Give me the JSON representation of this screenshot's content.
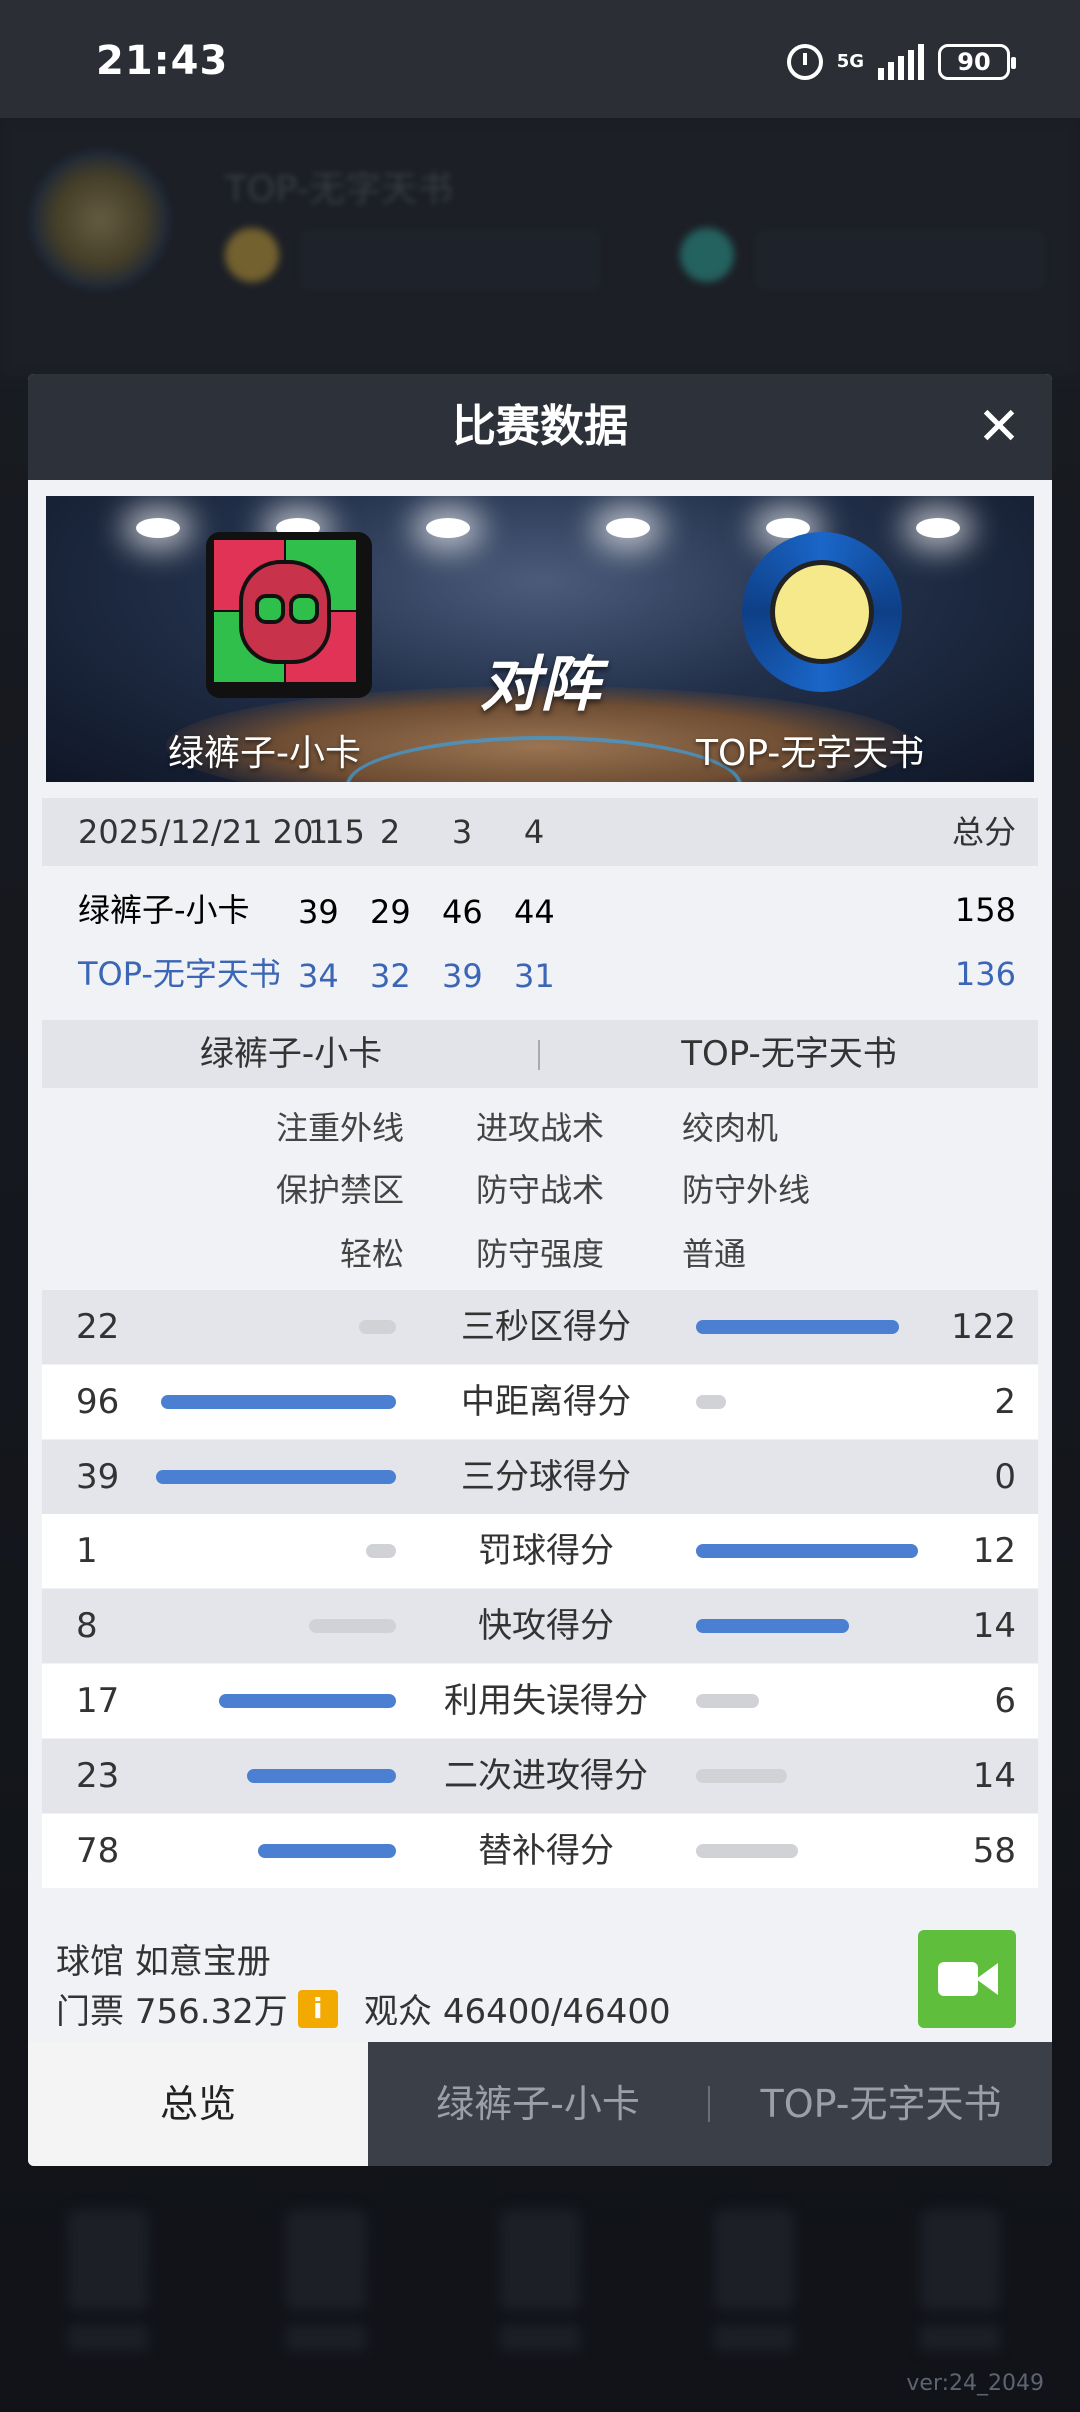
{
  "status_bar": {
    "time": "21:43",
    "network": "5G",
    "battery": "90"
  },
  "background": {
    "player_name": "TOP-无字天书",
    "version": "ver:24_2049"
  },
  "modal": {
    "title": "比赛数据",
    "close_icon": "✕",
    "banner": {
      "vs_text": "对阵",
      "home_team": "绿裤子-小卡",
      "away_team": "TOP-无字天书"
    },
    "score_table": {
      "date": "2025/12/21 20:15",
      "quarters": [
        "1",
        "2",
        "3",
        "4"
      ],
      "total_label": "总分",
      "rows": [
        {
          "team": "绿裤子-小卡",
          "scores": [
            "39",
            "29",
            "46",
            "44"
          ],
          "total": "158"
        },
        {
          "team": "TOP-无字天书",
          "scores": [
            "34",
            "32",
            "39",
            "31"
          ],
          "total": "136"
        }
      ]
    },
    "teams_bar": {
      "left": "绿裤子-小卡",
      "right": "TOP-无字天书"
    },
    "tactics": [
      {
        "left": "注重外线",
        "middle": "进攻战术",
        "right": "绞肉机"
      },
      {
        "left": "保护禁区",
        "middle": "防守战术",
        "right": "防守外线"
      },
      {
        "left": "轻松",
        "middle": "防守强度",
        "right": "普通"
      }
    ],
    "stats": [
      {
        "label": "三秒区得分",
        "left": "22",
        "right": "122"
      },
      {
        "label": "中距离得分",
        "left": "96",
        "right": "2"
      },
      {
        "label": "三分球得分",
        "left": "39",
        "right": "0"
      },
      {
        "label": "罚球得分",
        "left": "1",
        "right": "12"
      },
      {
        "label": "快攻得分",
        "left": "8",
        "right": "14"
      },
      {
        "label": "利用失误得分",
        "left": "17",
        "right": "6"
      },
      {
        "label": "二次进攻得分",
        "left": "23",
        "right": "14"
      },
      {
        "label": "替补得分",
        "left": "78",
        "right": "58"
      }
    ],
    "footer": {
      "venue_label": "球馆",
      "venue_name": "如意宝册",
      "ticket_label": "门票",
      "ticket_value": "756.32万",
      "info_icon": "i",
      "audience_label": "观众",
      "audience_value": "46400/46400",
      "video_icon": "video-camera-icon"
    },
    "tabs": [
      {
        "label": "总览",
        "active": true
      },
      {
        "label": "绿裤子-小卡",
        "active": false
      },
      {
        "label": "TOP-无字天书",
        "active": false
      }
    ]
  },
  "colors": {
    "accent_blue": "#4b7fd1",
    "video_green": "#5fbf3c",
    "info_orange": "#f2a900"
  }
}
